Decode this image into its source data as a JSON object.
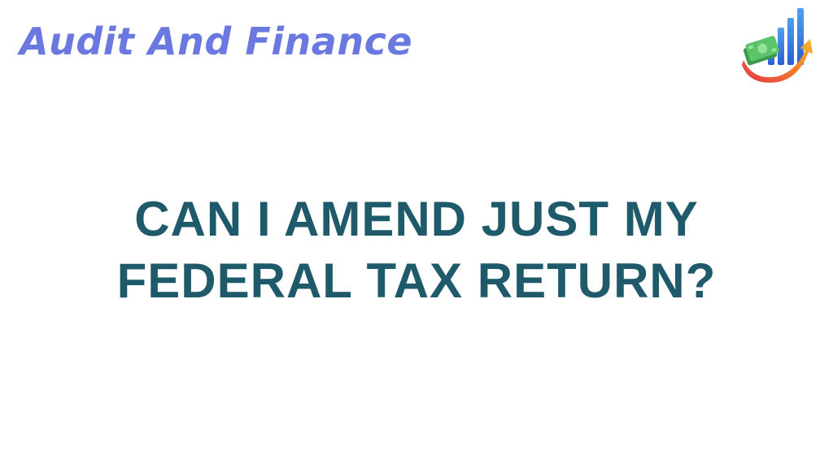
{
  "header": {
    "brand_name": "Audit And Finance",
    "logo_icon": "chart-money-arrow-icon"
  },
  "article": {
    "title_line1": "CAN I AMEND JUST MY",
    "title_line2": "FEDERAL TAX RETURN?"
  },
  "colors": {
    "brand": "#6a78e0",
    "headline": "#1f5a6b",
    "background": "#ffffff"
  }
}
